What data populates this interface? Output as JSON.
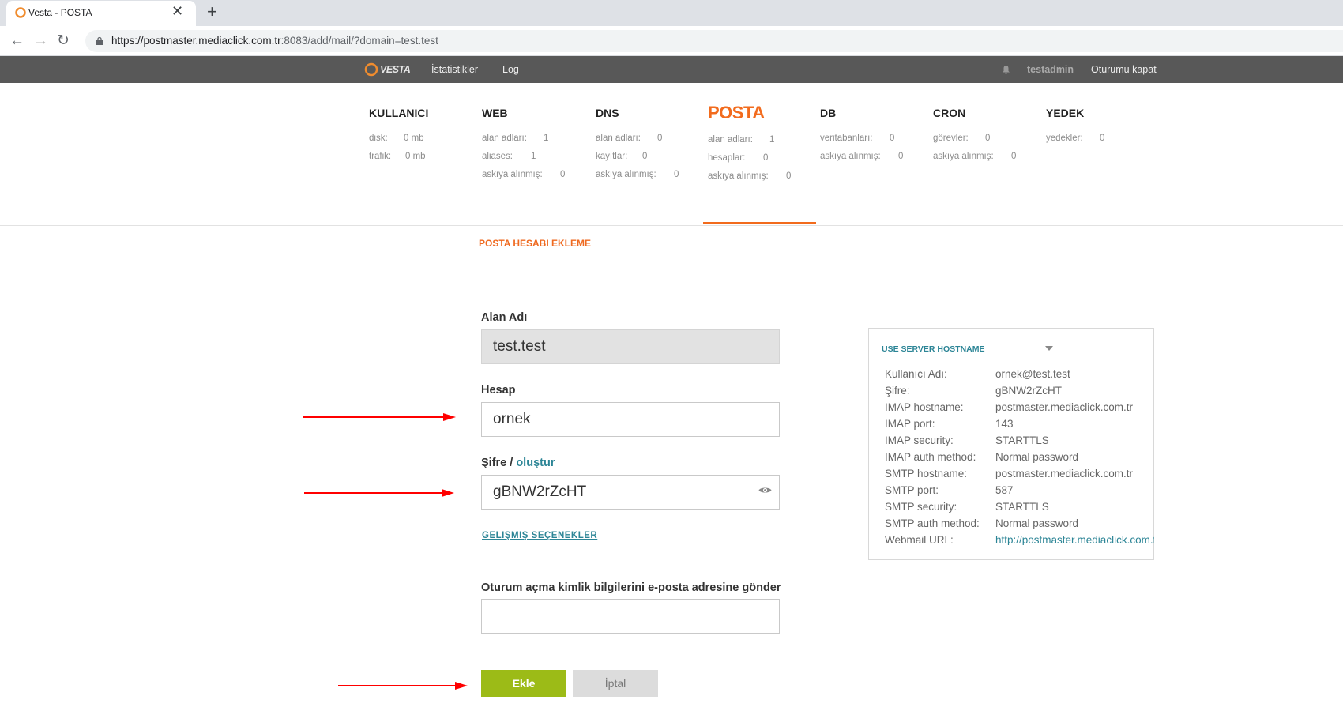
{
  "browser": {
    "tab_title": "Vesta - POSTA",
    "url_host": "https://postmaster.mediaclick.com.tr",
    "url_path": ":8083/add/mail/?domain=test.test"
  },
  "topbar": {
    "logo": "VESTA",
    "nav": [
      "İstatistikler",
      "Log"
    ],
    "user": "testadmin",
    "logout": "Oturumu kapat"
  },
  "stats": {
    "kullanici": {
      "title": "KULLANICI",
      "rows": [
        {
          "label": "disk:",
          "value": "0 mb"
        },
        {
          "label": "trafik:",
          "value": "0 mb"
        }
      ]
    },
    "web": {
      "title": "WEB",
      "rows": [
        {
          "label": "alan adları:",
          "value": "1"
        },
        {
          "label": "aliases:",
          "value": "1"
        },
        {
          "label": "askıya alınmış:",
          "value": "0"
        }
      ]
    },
    "dns": {
      "title": "DNS",
      "rows": [
        {
          "label": "alan adları:",
          "value": "0"
        },
        {
          "label": "kayıtlar:",
          "value": "0"
        },
        {
          "label": "askıya alınmış:",
          "value": "0"
        }
      ]
    },
    "posta": {
      "title": "POSTA",
      "rows": [
        {
          "label": "alan adları:",
          "value": "1"
        },
        {
          "label": "hesaplar:",
          "value": "0"
        },
        {
          "label": "askıya alınmış:",
          "value": "0"
        }
      ]
    },
    "db": {
      "title": "DB",
      "rows": [
        {
          "label": "veritabanları:",
          "value": "0"
        },
        {
          "label": "askıya alınmış:",
          "value": "0"
        }
      ]
    },
    "cron": {
      "title": "CRON",
      "rows": [
        {
          "label": "görevler:",
          "value": "0"
        },
        {
          "label": "askıya alınmış:",
          "value": "0"
        }
      ]
    },
    "yedek": {
      "title": "YEDEK",
      "rows": [
        {
          "label": "yedekler:",
          "value": "0"
        }
      ]
    }
  },
  "page_heading": "POSTA HESABI EKLEME",
  "form": {
    "domain_label": "Alan Adı",
    "domain_value": "test.test",
    "account_label": "Hesap",
    "account_value": "ornek",
    "password_label": "Şifre /",
    "password_generate": "oluştur",
    "password_value": "gBNW2rZcHT",
    "advanced_link": "GELIŞMIŞ SEÇENEKLER",
    "send_label": "Oturum açma kimlik bilgilerini e-posta adresine gönder",
    "send_value": "",
    "add_button": "Ekle",
    "cancel_button": "İptal"
  },
  "info_panel": {
    "select_value": "USE SERVER HOSTNAME",
    "rows": [
      {
        "key": "Kullanıcı Adı:",
        "value": "ornek@test.test"
      },
      {
        "key": "Şifre:",
        "value": "gBNW2rZcHT"
      },
      {
        "key": "IMAP hostname:",
        "value": "postmaster.mediaclick.com.tr"
      },
      {
        "key": "IMAP port:",
        "value": "143"
      },
      {
        "key": "IMAP security:",
        "value": "STARTTLS"
      },
      {
        "key": "IMAP auth method:",
        "value": "Normal password"
      },
      {
        "key": "SMTP hostname:",
        "value": "postmaster.mediaclick.com.tr"
      },
      {
        "key": "SMTP port:",
        "value": "587"
      },
      {
        "key": "SMTP security:",
        "value": "STARTTLS"
      },
      {
        "key": "SMTP auth method:",
        "value": "Normal password"
      },
      {
        "key": "Webmail URL:",
        "value": "http://postmaster.mediaclick.com.tr"
      }
    ]
  },
  "colors": {
    "accent": "#f26b1d",
    "teal": "#2c8596",
    "add_green": "#9cbb17",
    "annotation_red": "#ff0000"
  }
}
